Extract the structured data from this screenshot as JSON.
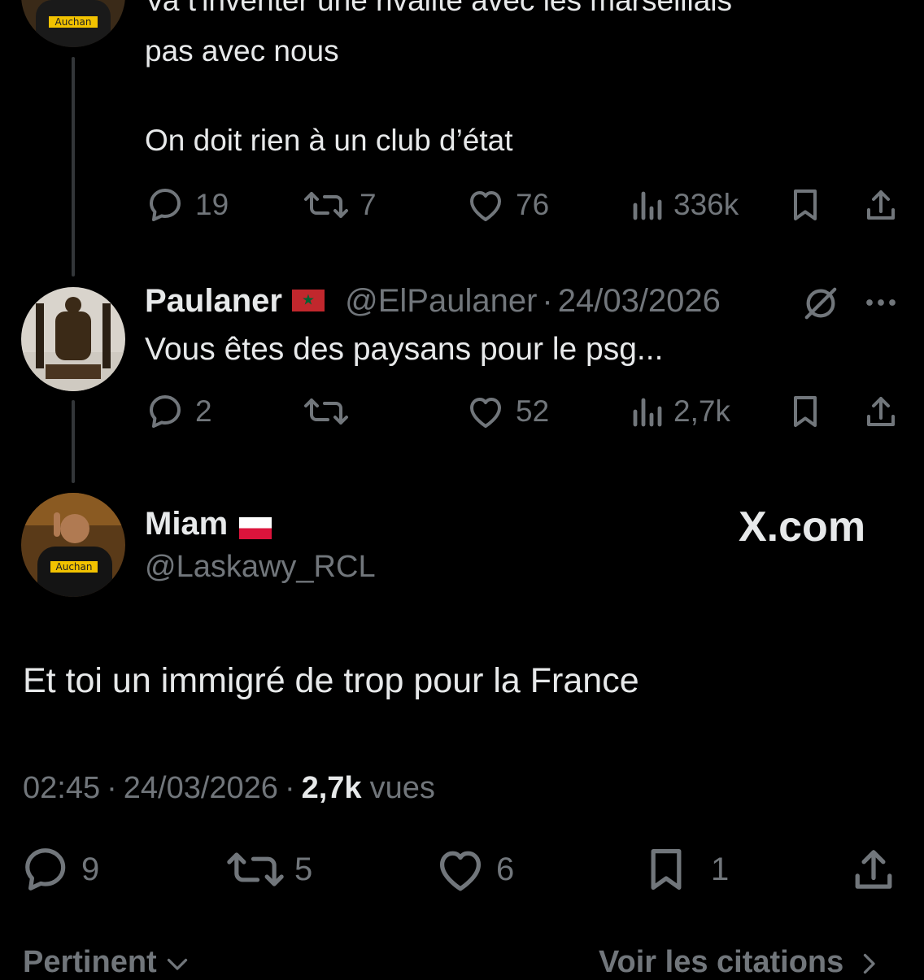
{
  "top_tweet": {
    "text_line1": "Va t'inventer une rivalité avec les marseillais",
    "text_line2": "pas avec nous",
    "text_line3": "On doit rien à un club d’état",
    "actions": {
      "replies": "19",
      "reposts": "7",
      "likes": "76",
      "views": "336k"
    }
  },
  "reply_tweet": {
    "author_name": "Paulaner",
    "author_handle": "@ElPaulaner",
    "separator": "·",
    "date": "24/03/2026",
    "text": "Vous êtes des paysans pour le psg...",
    "actions": {
      "replies": "2",
      "reposts": "",
      "likes": "52",
      "views": "2,7k"
    }
  },
  "main_tweet": {
    "author_name": "Miam",
    "author_handle": "@Laskawy_RCL",
    "brand": "X.com",
    "text": "Et toi un immigré de trop pour la France",
    "time": "02:45",
    "separator": "·",
    "date": "24/03/2026",
    "separator2": "·",
    "views_count": "2,7k",
    "views_label": "vues",
    "actions": {
      "replies": "9",
      "reposts": "5",
      "likes": "6",
      "bookmarks": "1"
    }
  },
  "footer": {
    "sort_label": "Pertinent",
    "quotes_link": "Voir les citations"
  },
  "icons": {
    "reply": "reply-icon",
    "repost": "repost-icon",
    "like": "like-icon",
    "views": "views-icon",
    "bookmark": "bookmark-icon",
    "share": "share-icon",
    "grok": "grok-icon",
    "more": "more-icon"
  },
  "colors": {
    "background": "#000000",
    "text": "#e7e9ea",
    "muted": "#71767b",
    "thread_line": "#333639"
  }
}
